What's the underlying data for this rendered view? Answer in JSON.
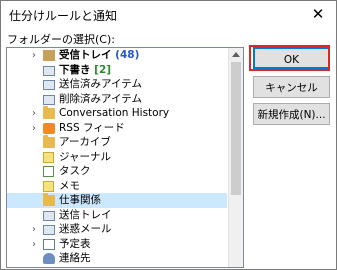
{
  "dialog": {
    "title": "仕分けルールと通知",
    "close_glyph": "✕",
    "folder_label": "フォルダーの選択(C):"
  },
  "tree": {
    "items": [
      {
        "expand": "›",
        "icon": "inbox-icon",
        "label": "受信トレイ",
        "count": "(48)",
        "bold": true,
        "count_color": "blue"
      },
      {
        "expand": "",
        "icon": "drafts-icon",
        "label": "下書き",
        "count": "[2]",
        "bold": true,
        "count_color": "green"
      },
      {
        "expand": "",
        "icon": "sent-items-icon",
        "label": "送信済みアイテム",
        "count": "",
        "bold": false
      },
      {
        "expand": "",
        "icon": "deleted-items-icon",
        "label": "削除済みアイテム",
        "count": "",
        "bold": false
      },
      {
        "expand": "›",
        "icon": "folder-icon",
        "label": "Conversation History",
        "count": "",
        "bold": false
      },
      {
        "expand": "›",
        "icon": "rss-icon",
        "label": "RSS フィード",
        "count": "",
        "bold": false
      },
      {
        "expand": "",
        "icon": "folder-icon",
        "label": "アーカイブ",
        "count": "",
        "bold": false
      },
      {
        "expand": "",
        "icon": "journal-icon",
        "label": "ジャーナル",
        "count": "",
        "bold": false
      },
      {
        "expand": "",
        "icon": "task-icon",
        "label": "タスク",
        "count": "",
        "bold": false
      },
      {
        "expand": "",
        "icon": "note-icon",
        "label": "メモ",
        "count": "",
        "bold": false
      },
      {
        "expand": "",
        "icon": "folder-icon",
        "label": "仕事関係",
        "count": "",
        "bold": false,
        "selected": true
      },
      {
        "expand": "",
        "icon": "outbox-icon",
        "label": "送信トレイ",
        "count": "",
        "bold": false
      },
      {
        "expand": "›",
        "icon": "junk-mail-icon",
        "label": "迷惑メール",
        "count": "",
        "bold": false
      },
      {
        "expand": "›",
        "icon": "calendar-icon",
        "label": "予定表",
        "count": "",
        "bold": false
      },
      {
        "expand": "",
        "icon": "contacts-icon",
        "label": "連絡先",
        "count": "",
        "bold": false
      }
    ]
  },
  "buttons": {
    "ok": "OK",
    "cancel": "キャンセル",
    "new_folder": "新規作成(N)..."
  },
  "colors": {
    "highlight": "#e0252a",
    "selection": "#cce8ff",
    "count_blue": "#2a56c6",
    "count_green": "#2a8a2a"
  }
}
